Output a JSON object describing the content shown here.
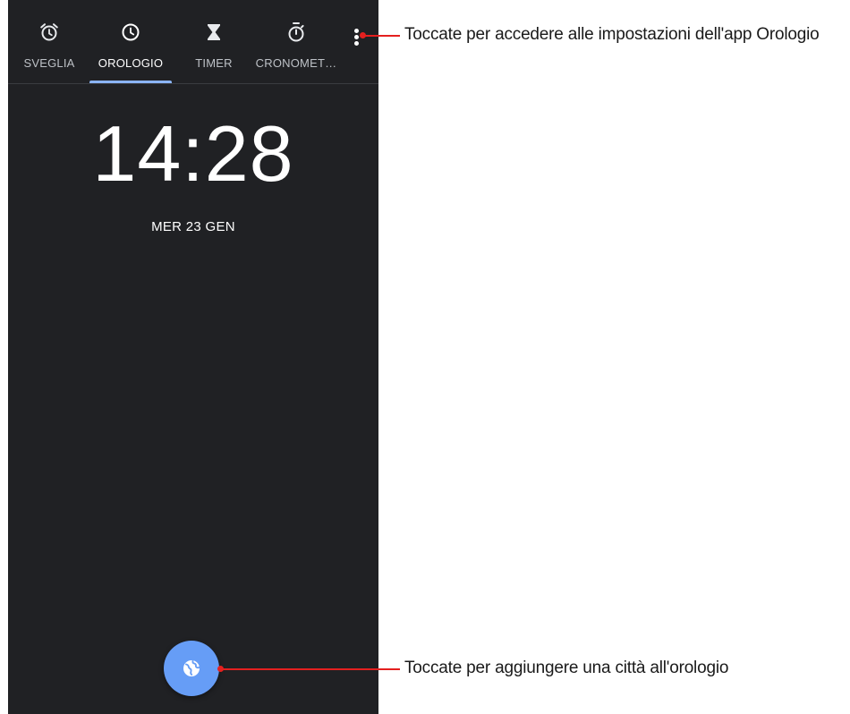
{
  "tabs": [
    {
      "label": "SVEGLIA",
      "icon": "alarm-icon",
      "active": false
    },
    {
      "label": "OROLOGIO",
      "icon": "clock-icon",
      "active": true
    },
    {
      "label": "TIMER",
      "icon": "hourglass-icon",
      "active": false
    },
    {
      "label": "CRONOMET…",
      "icon": "stopwatch-icon",
      "active": false
    }
  ],
  "more_menu": {
    "icon": "more-vert-icon"
  },
  "clock": {
    "time": "14:28",
    "date": "MER 23 GEN"
  },
  "fab": {
    "icon": "globe-icon"
  },
  "annotations": {
    "settings": "Toccate per accedere alle impostazioni dell'app Orologio",
    "add_city": "Toccate per aggiungere una città all'orologio"
  },
  "colors": {
    "background": "#202124",
    "accent": "#8ab4f8",
    "fab": "#669df6",
    "callout": "#e4201f"
  }
}
